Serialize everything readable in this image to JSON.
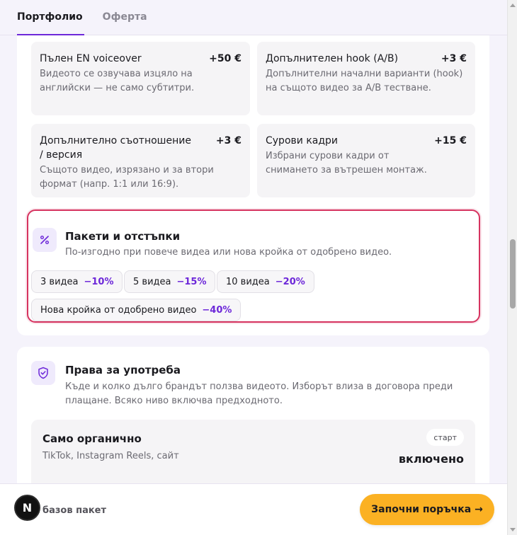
{
  "tabs": [
    {
      "label": "Портфолио",
      "active": true
    },
    {
      "label": "Оферта",
      "active": false
    }
  ],
  "addons": [
    {
      "name": "Пълен EN voiceover",
      "price": "+50 €",
      "desc": "Видеото се озвучава изцяло на английски — не само субтитри."
    },
    {
      "name": "Допълнителен hook (A/B)",
      "price": "+3 €",
      "desc": "Допълнителни начални варианти (hook) на същото видео за A/B тестване."
    },
    {
      "name": "Допълнително съотношение / версия",
      "price": "+3 €",
      "desc": "Същото видео, изрязано и за втори формат (напр. 1:1 или 16:9)."
    },
    {
      "name": "Сурови кадри",
      "price": "+15 €",
      "desc": "Избрани сурови кадри от снимането за вътрешен монтаж."
    }
  ],
  "packages": {
    "icon": "percent-icon",
    "title": "Пакети и отстъпки",
    "subtitle": "По-изгодно при повече видеа или нова кройка от одобрено видео.",
    "chips": [
      {
        "label": "3 видеа",
        "discount": "−10%"
      },
      {
        "label": "5 видеа",
        "discount": "−15%"
      },
      {
        "label": "10 видеа",
        "discount": "−20%"
      },
      {
        "label": "Нова кройка от одобрено видео",
        "discount": "−40%"
      }
    ]
  },
  "rights": {
    "icon": "shield-check-icon",
    "title": "Права за употреба",
    "subtitle": "Къде и колко дълго брандът ползва видеото. Изборът влиза в договора преди плащане. Всяко ниво включва предходното.",
    "tier": {
      "name": "Само органично",
      "desc": "TikTok, Instagram Reels, сайт",
      "badge": "старт",
      "status": "включено"
    }
  },
  "bottom": {
    "avatar_letter": "N",
    "base_label": "базов пакет",
    "cta_label": "Започни поръчка →"
  },
  "colors": {
    "accent": "#6d28d9",
    "highlight_border": "#d6335f",
    "cta": "#fbb123"
  }
}
